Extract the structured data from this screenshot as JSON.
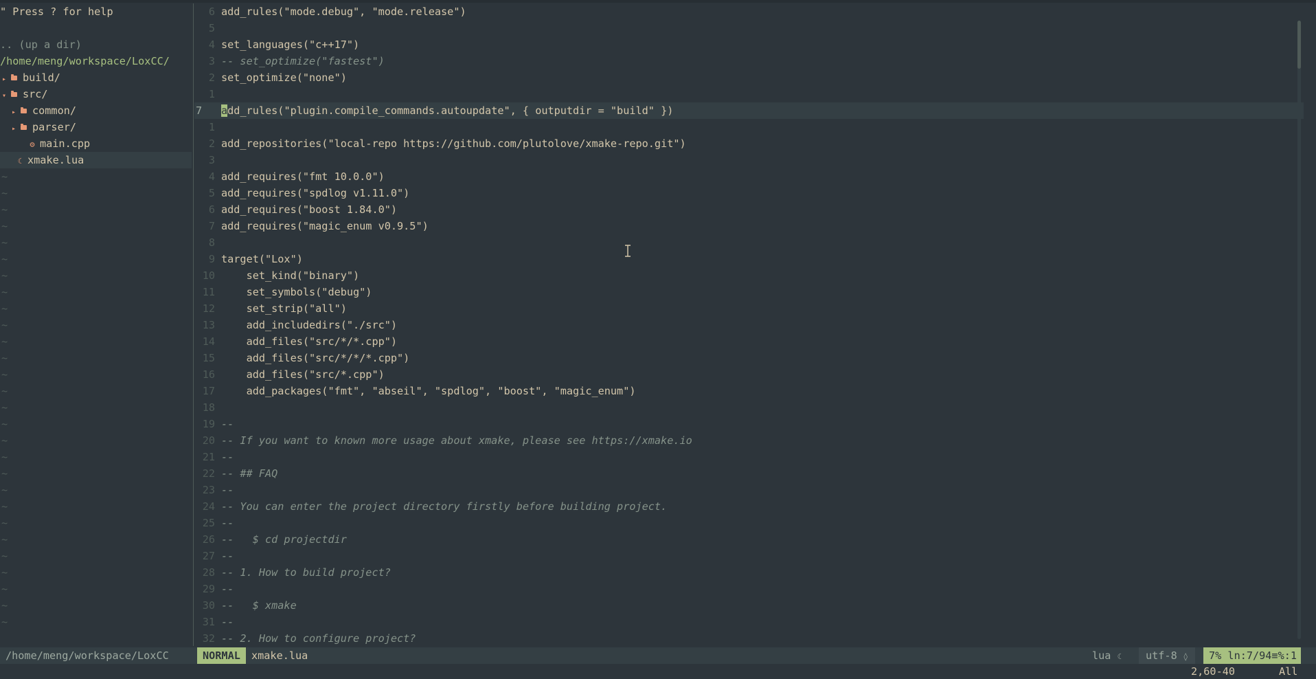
{
  "tree": {
    "help": "\" Press ? for help",
    "up_dir": ".. (up a dir)",
    "root": "/home/meng/workspace/LoxCC/",
    "entries": [
      {
        "label": "build/",
        "kind": "dir",
        "arrow": "▸"
      },
      {
        "label": "src/",
        "kind": "dir",
        "arrow": "▾"
      },
      {
        "label": "common/",
        "kind": "dir",
        "arrow": "▸"
      },
      {
        "label": "parser/",
        "kind": "dir",
        "arrow": "▸"
      },
      {
        "label": "main.cpp",
        "kind": "cpp-file"
      },
      {
        "label": "xmake.lua",
        "kind": "lua-file"
      }
    ],
    "tilde": "~"
  },
  "editor": {
    "lines": [
      {
        "num": "6",
        "text": "add_rules(\"mode.debug\", \"mode.release\")"
      },
      {
        "num": "5",
        "text": ""
      },
      {
        "num": "4",
        "text": "set_languages(\"c++17\")"
      },
      {
        "num": "3",
        "text": "-- set_optimize(\"fastest\")"
      },
      {
        "num": "2",
        "text": "set_optimize(\"none\")"
      },
      {
        "num": "1",
        "text": ""
      },
      {
        "num": "7",
        "text": "add_rules(\"plugin.compile_commands.autoupdate\", { outputdir = \"build\" })"
      },
      {
        "num": "1",
        "text": ""
      },
      {
        "num": "2",
        "text": "add_repositories(\"local-repo https://github.com/plutolove/xmake-repo.git\")"
      },
      {
        "num": "3",
        "text": ""
      },
      {
        "num": "4",
        "text": "add_requires(\"fmt 10.0.0\")"
      },
      {
        "num": "5",
        "text": "add_requires(\"spdlog v1.11.0\")"
      },
      {
        "num": "6",
        "text": "add_requires(\"boost 1.84.0\")"
      },
      {
        "num": "7",
        "text": "add_requires(\"magic_enum v0.9.5\")"
      },
      {
        "num": "8",
        "text": ""
      },
      {
        "num": "9",
        "text": "target(\"Lox\")"
      },
      {
        "num": "10",
        "text": "    set_kind(\"binary\")"
      },
      {
        "num": "11",
        "text": "    set_symbols(\"debug\")"
      },
      {
        "num": "12",
        "text": "    set_strip(\"all\")"
      },
      {
        "num": "13",
        "text": "    add_includedirs(\"./src\")"
      },
      {
        "num": "14",
        "text": "    add_files(\"src/*/*.cpp\")"
      },
      {
        "num": "15",
        "text": "    add_files(\"src/*/*/*.cpp\")"
      },
      {
        "num": "16",
        "text": "    add_files(\"src/*.cpp\")"
      },
      {
        "num": "17",
        "text": "    add_packages(\"fmt\", \"abseil\", \"spdlog\", \"boost\", \"magic_enum\")"
      },
      {
        "num": "18",
        "text": ""
      },
      {
        "num": "19",
        "text": "--"
      },
      {
        "num": "20",
        "text": "-- If you want to known more usage about xmake, please see https://xmake.io"
      },
      {
        "num": "21",
        "text": "--"
      },
      {
        "num": "22",
        "text": "-- ## FAQ"
      },
      {
        "num": "23",
        "text": "--"
      },
      {
        "num": "24",
        "text": "-- You can enter the project directory firstly before building project."
      },
      {
        "num": "25",
        "text": "--"
      },
      {
        "num": "26",
        "text": "--   $ cd projectdir"
      },
      {
        "num": "27",
        "text": "--"
      },
      {
        "num": "28",
        "text": "-- 1. How to build project?"
      },
      {
        "num": "29",
        "text": "--"
      },
      {
        "num": "30",
        "text": "--   $ xmake"
      },
      {
        "num": "31",
        "text": "--"
      },
      {
        "num": "32",
        "text": "-- 2. How to configure project?"
      }
    ],
    "current_line_index": 6
  },
  "statusline": {
    "path": "/home/meng/workspace/LoxCC",
    "mode": "NORMAL",
    "filename": "xmake.lua",
    "filetype": "lua",
    "encoding": "utf-8",
    "position": "7% ln:7/94≡%:1"
  },
  "cmdline": {
    "ruler": "2,60-40",
    "scroll": "All"
  },
  "colors": {
    "background": "#2d353b",
    "accent_green": "#a7c080",
    "orange": "#e69875",
    "comment": "#859289"
  }
}
